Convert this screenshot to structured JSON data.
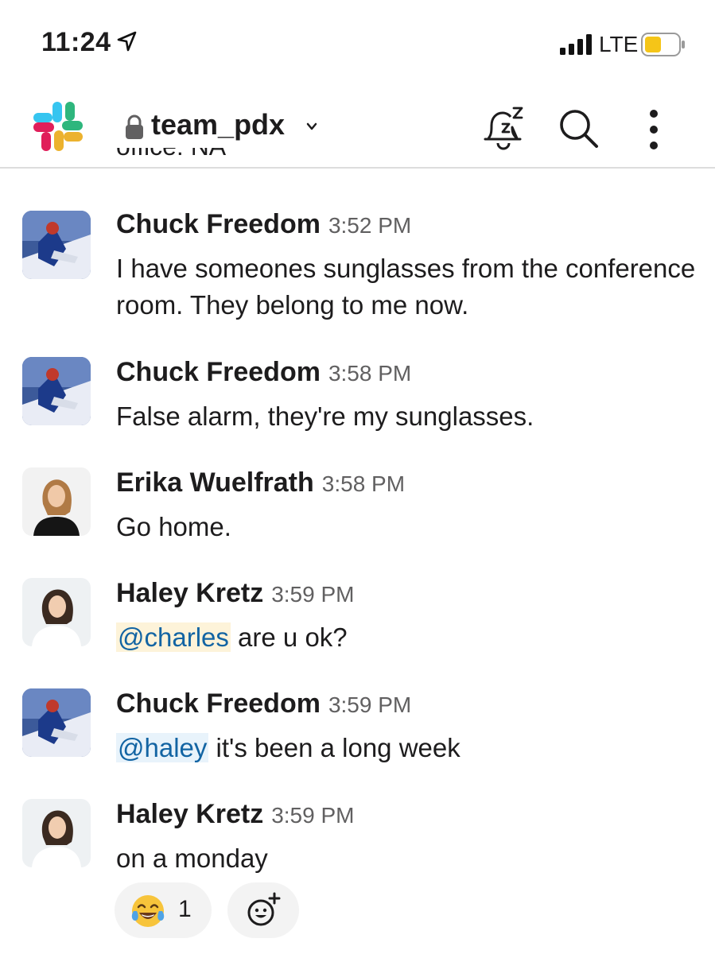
{
  "status_bar": {
    "time": "11:24",
    "network": "LTE"
  },
  "header": {
    "channel": "team_pdx"
  },
  "cut_off_text": "office: NA",
  "messages": [
    {
      "author": "Chuck Freedom",
      "time": "3:52 PM",
      "text": "I have someones sunglasses from the conference room. They belong to me now."
    },
    {
      "author": "Chuck Freedom",
      "time": "3:58 PM",
      "text": "False alarm, they're my sunglasses."
    },
    {
      "author": "Erika Wuelfrath",
      "time": "3:58 PM",
      "text": "Go home."
    },
    {
      "author": "Haley Kretz",
      "time": "3:59 PM",
      "mention": "@charles",
      "text": " are u ok?"
    },
    {
      "author": "Chuck Freedom",
      "time": "3:59 PM",
      "mention": "@haley",
      "text": " it's been a long week"
    },
    {
      "author": "Haley Kretz",
      "time": "3:59 PM",
      "text": "on a monday"
    }
  ],
  "reactions": [
    {
      "emoji": "joy-emoji",
      "count": "1"
    }
  ],
  "colors": {
    "mention_text": "#1264a3",
    "mention_bg_yellow": "#fdf3d9",
    "mention_bg_blue": "#e8f3fb",
    "timestamp": "#616061"
  }
}
